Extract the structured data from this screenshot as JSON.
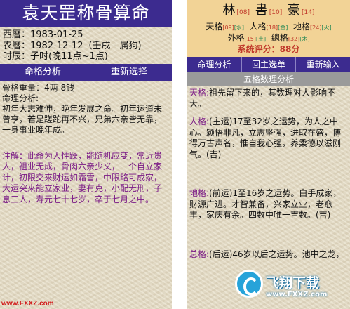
{
  "left": {
    "title": "袁天罡称骨算命",
    "info": {
      "gregorian": "西曆：1983-01-25",
      "lunar": "农曆：1982-12-12（壬戌 - 属狗)",
      "hour": "时辰：子时(晚11点~1点)"
    },
    "buttons": [
      "命格分析",
      "重新选择"
    ],
    "bone_weight": "骨格重量：4两 8钱",
    "analysis_label": "命理分析:",
    "analysis_text": "初年大志难伸，晚年发展之命。初年运道未曾亨，若是蹉跎再不兴，兄弟六亲皆无靠，一身事业晚年成。",
    "note_text": "注解：此命为人性躁，能随机应变，常近贵人，祖业无成，骨肉六亲少义，一个自立家计，初限交来财运如霜雪，中限略可成家，大运突来能立家业，妻有克，小配无刑，子息三人，寿元七十七岁，卒于七月之中。"
  },
  "right": {
    "name": [
      {
        "char": "林",
        "num": "[08]"
      },
      {
        "char": "書",
        "num": "[10]"
      },
      {
        "char": "豪",
        "num": "[14]"
      }
    ],
    "grid_row1": [
      {
        "label": "天格",
        "num": "[09]",
        "el": "[水]"
      },
      {
        "label": "人格",
        "num": "[18]",
        "el": "[金]"
      },
      {
        "label": "地格",
        "num": "[24]",
        "el": "[火]"
      }
    ],
    "grid_row2": [
      {
        "label": "外格",
        "num": "[15]",
        "el": "[土]"
      },
      {
        "label": "總格",
        "num": "[32]",
        "el": "[木]"
      }
    ],
    "score_label": "系统评分：",
    "score_value": "88分",
    "buttons": [
      "命理分析",
      "回主选单",
      "重新输入"
    ],
    "section_title": "五格数理分析",
    "paras": [
      {
        "label": "天格:",
        "text": "祖先留下来的，其数理对人影响不大。"
      },
      {
        "label": "人格:",
        "text": "(主运)17至32岁之运势，为人之中心。颖悟非凡，立志坚强，进取在盛，博得万古声名，惟自我心强，养柔德以滋刚气。(吉)"
      },
      {
        "label": "地格:",
        "text": "(前运)1至16岁之运势。白手成家，财源广进。才智兼备，兴家立业，老愈丰，家庆有余。四数中唯一吉数。(吉)"
      },
      {
        "label": "总格:",
        "text": "(后运)46岁以后之运势。池中之龙，"
      }
    ]
  },
  "watermark": {
    "left_url": "www.FXXZ.com",
    "right_cn": "飞翔下载",
    "right_url": "www.FXXZ.com"
  }
}
